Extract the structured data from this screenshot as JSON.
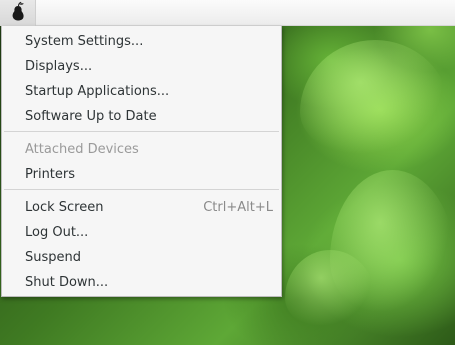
{
  "menu": {
    "items": [
      {
        "label": "System Settings..."
      },
      {
        "label": "Displays..."
      },
      {
        "label": "Startup Applications..."
      },
      {
        "label": "Software Up to Date"
      },
      {
        "label": "Attached Devices"
      },
      {
        "label": "Printers"
      },
      {
        "label": "Lock Screen",
        "shortcut": "Ctrl+Alt+L"
      },
      {
        "label": "Log Out..."
      },
      {
        "label": "Suspend"
      },
      {
        "label": "Shut Down..."
      }
    ]
  },
  "topbar": {
    "app_icon": "pear-icon"
  },
  "colors": {
    "menu_bg": "#f6f6f6",
    "text": "#2e3436",
    "disabled_text": "#9a9a9a"
  }
}
